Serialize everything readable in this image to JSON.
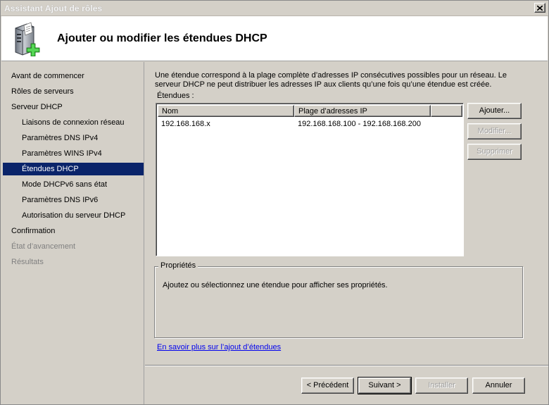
{
  "window": {
    "title": "Assistant Ajout de rôles"
  },
  "header": {
    "title": "Ajouter ou modifier les étendues DHCP",
    "icon": "server-add-icon"
  },
  "nav": {
    "items": [
      {
        "label": "Avant de commencer",
        "state": "normal"
      },
      {
        "label": "Rôles de serveurs",
        "state": "normal"
      },
      {
        "label": "Serveur DHCP",
        "state": "normal"
      },
      {
        "label": "Liaisons de connexion réseau",
        "state": "normal"
      },
      {
        "label": "Paramètres DNS IPv4",
        "state": "normal"
      },
      {
        "label": "Paramètres WINS IPv4",
        "state": "normal"
      },
      {
        "label": "Étendues DHCP",
        "state": "active"
      },
      {
        "label": "Mode DHCPv6 sans état",
        "state": "normal"
      },
      {
        "label": "Paramètres DNS IPv6",
        "state": "normal"
      },
      {
        "label": "Autorisation du serveur DHCP",
        "state": "normal"
      },
      {
        "label": "Confirmation",
        "state": "normal"
      },
      {
        "label": "État d’avancement",
        "state": "disabled"
      },
      {
        "label": "Résultats",
        "state": "disabled"
      }
    ]
  },
  "main": {
    "description": "Une étendue correspond à la plage complète d’adresses IP consécutives possibles pour un réseau. Le serveur DHCP ne peut distribuer les adresses IP aux clients qu’une fois qu’une étendue est créée.",
    "scopes_label": "Étendues :",
    "table": {
      "columns": [
        "Nom",
        "Plage d’adresses IP"
      ],
      "rows": [
        {
          "name": "192.168.168.x",
          "range": "192.168.168.100 - 192.168.168.200"
        }
      ]
    },
    "buttons": {
      "add": "Ajouter...",
      "edit": "Modifier...",
      "delete": "Supprimer"
    },
    "properties": {
      "title": "Propriétés",
      "text": "Ajoutez ou sélectionnez une étendue pour afficher ses propriétés."
    },
    "link": "En savoir plus sur l’ajout d’étendues"
  },
  "footer": {
    "previous": "< Précédent",
    "next": "Suivant >",
    "install": "Installer",
    "cancel": "Annuler"
  }
}
